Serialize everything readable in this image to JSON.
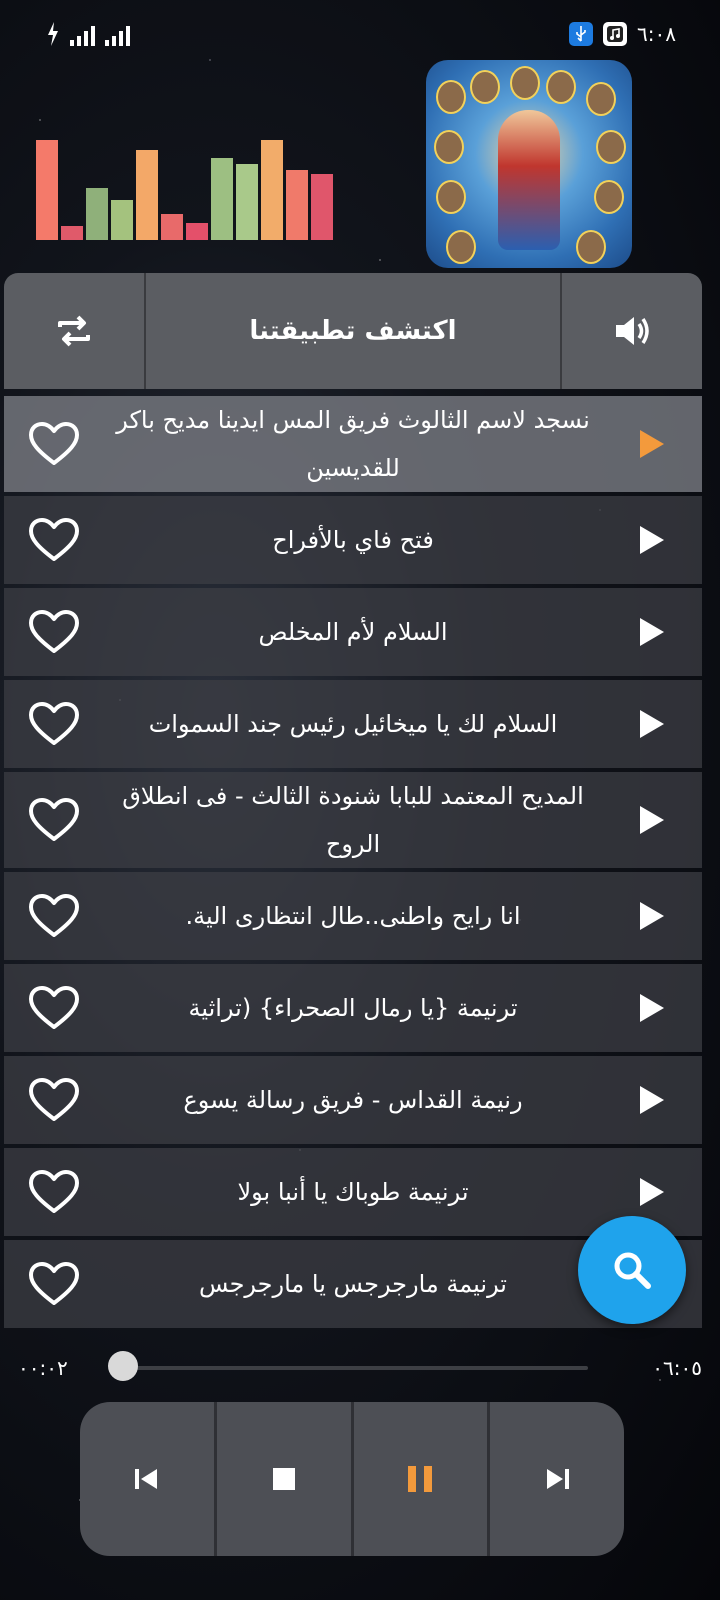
{
  "status": {
    "time": "٦:٠٨",
    "left_icons": [
      "charging-icon",
      "signal-icon",
      "signal-icon"
    ],
    "right_icons": [
      "usb-icon",
      "music-icon"
    ]
  },
  "visualizer": {
    "colors": [
      "#f47a6a",
      "#e05a6a",
      "#8fb07a",
      "#a4c27e",
      "#f3a868",
      "#e86a6a",
      "#e4506a",
      "#9dbf82",
      "#a9c98a",
      "#f2ac6a",
      "#f07a6a",
      "#e0566b"
    ],
    "levels": [
      1.0,
      0.14,
      0.52,
      0.4,
      0.9,
      0.26,
      0.17,
      0.82,
      0.76,
      1.0,
      0.7,
      0.66
    ]
  },
  "album_art": {
    "alt": "album-art"
  },
  "header": {
    "title": "اكتشف تطبيقتنا",
    "left_icon": "repeat-icon",
    "right_icon": "volume-icon"
  },
  "songs": [
    {
      "title": "نسجد لاسم الثالوث فريق المس ايدينا مديح باكر للقديسين",
      "active": true
    },
    {
      "title": "فتح فاي بالأفراح",
      "active": false
    },
    {
      "title": "السلام لأم المخلص",
      "active": false
    },
    {
      "title": "السلام لك يا ميخائيل رئيس جند السموات",
      "active": false
    },
    {
      "title": "المديح المعتمد للبابا شنودة الثالث - فى انطلاق الروح",
      "active": false
    },
    {
      "title": "انا رايح واطنى..طال انتظارى الية.",
      "active": false
    },
    {
      "title": "ترنيمة {يا رمال الصحراء} (تراثية",
      "active": false
    },
    {
      "title": "رنيمة القداس - فريق رسالة يسوع",
      "active": false
    },
    {
      "title": "ترنيمة طوباك يا أنبا بولا",
      "active": false
    },
    {
      "title": "ترنيمة مارجرجس يا مارجرجس",
      "active": false
    }
  ],
  "player": {
    "elapsed": "٠٠:٠٢",
    "duration": "٠٦:٠٥",
    "progress": 0.01,
    "play_active_color": "#f39a3c",
    "controls": [
      "previous-icon",
      "stop-icon",
      "pause-icon",
      "next-icon"
    ]
  },
  "fab": {
    "icon": "search-icon",
    "color": "#1fa3ec"
  }
}
